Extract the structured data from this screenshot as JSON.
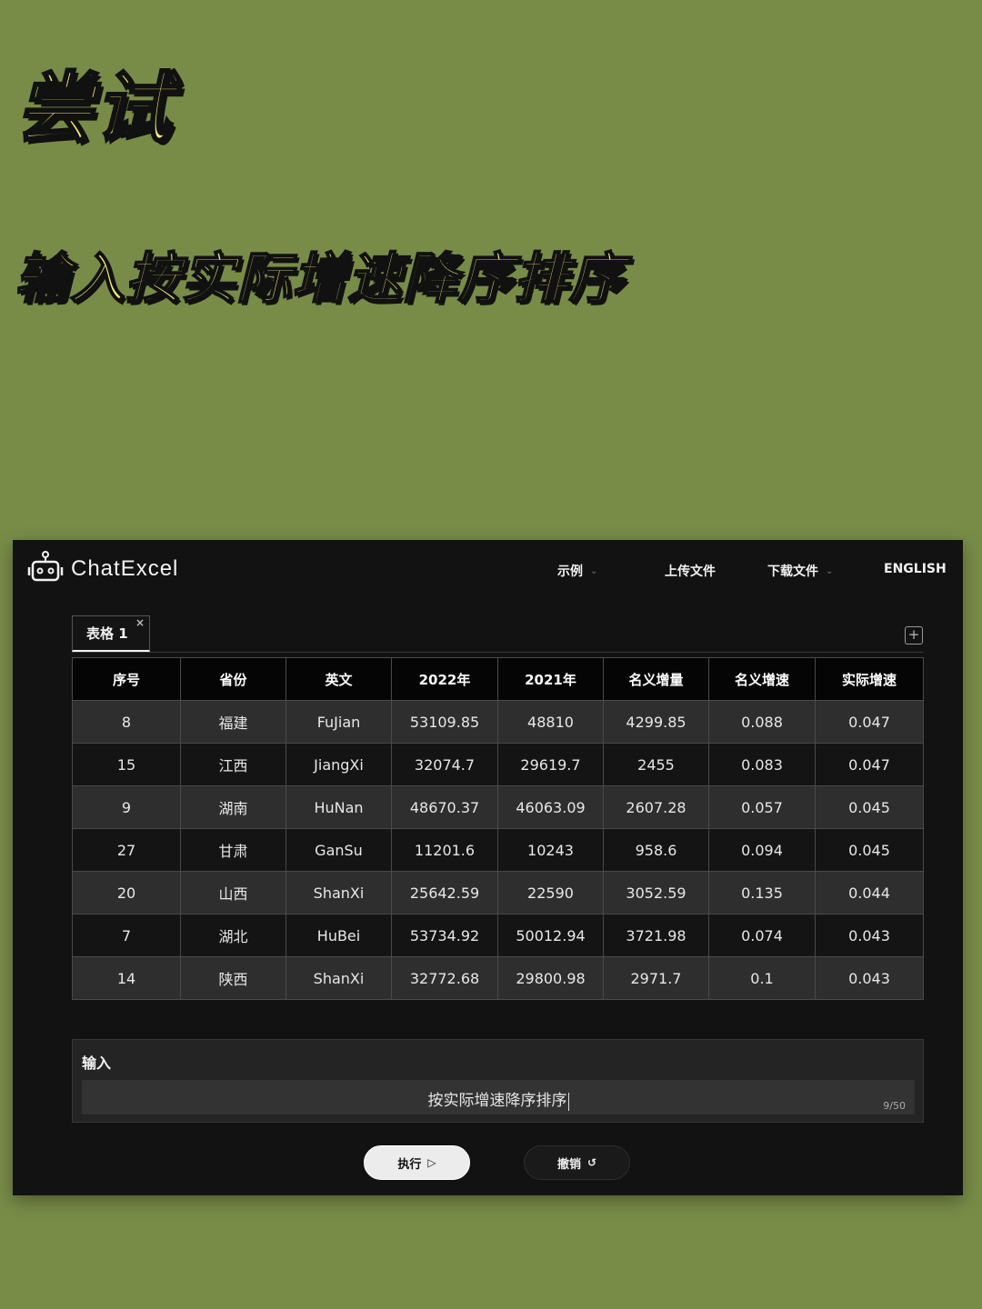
{
  "headline": "尝试",
  "subheadline": "输入按实际增速降序排序",
  "app": {
    "logo_text": "ChatExcel",
    "nav": {
      "examples": "示例",
      "upload": "上传文件",
      "download": "下载文件",
      "english": "ENGLISH"
    },
    "tab": {
      "label": "表格 1",
      "close": "×"
    },
    "add_sheet": "+",
    "table": {
      "headers": [
        "序号",
        "省份",
        "英文",
        "2022年",
        "2021年",
        "名义增量",
        "名义增速",
        "实际增速"
      ],
      "rows": [
        [
          "8",
          "福建",
          "FuJian",
          "53109.85",
          "48810",
          "4299.85",
          "0.088",
          "0.047"
        ],
        [
          "15",
          "江西",
          "JiangXi",
          "32074.7",
          "29619.7",
          "2455",
          "0.083",
          "0.047"
        ],
        [
          "9",
          "湖南",
          "HuNan",
          "48670.37",
          "46063.09",
          "2607.28",
          "0.057",
          "0.045"
        ],
        [
          "27",
          "甘肃",
          "GanSu",
          "11201.6",
          "10243",
          "958.6",
          "0.094",
          "0.045"
        ],
        [
          "20",
          "山西",
          "ShanXi",
          "25642.59",
          "22590",
          "3052.59",
          "0.135",
          "0.044"
        ],
        [
          "7",
          "湖北",
          "HuBei",
          "53734.92",
          "50012.94",
          "3721.98",
          "0.074",
          "0.043"
        ],
        [
          "14",
          "陕西",
          "ShanXi",
          "32772.68",
          "29800.98",
          "2971.7",
          "0.1",
          "0.043"
        ]
      ]
    },
    "input": {
      "label": "输入",
      "value": "按实际增速降序排序",
      "counter": "9/50"
    },
    "buttons": {
      "run": "执行",
      "run_icon": "▷",
      "undo": "撤销",
      "undo_icon": "↺"
    }
  }
}
